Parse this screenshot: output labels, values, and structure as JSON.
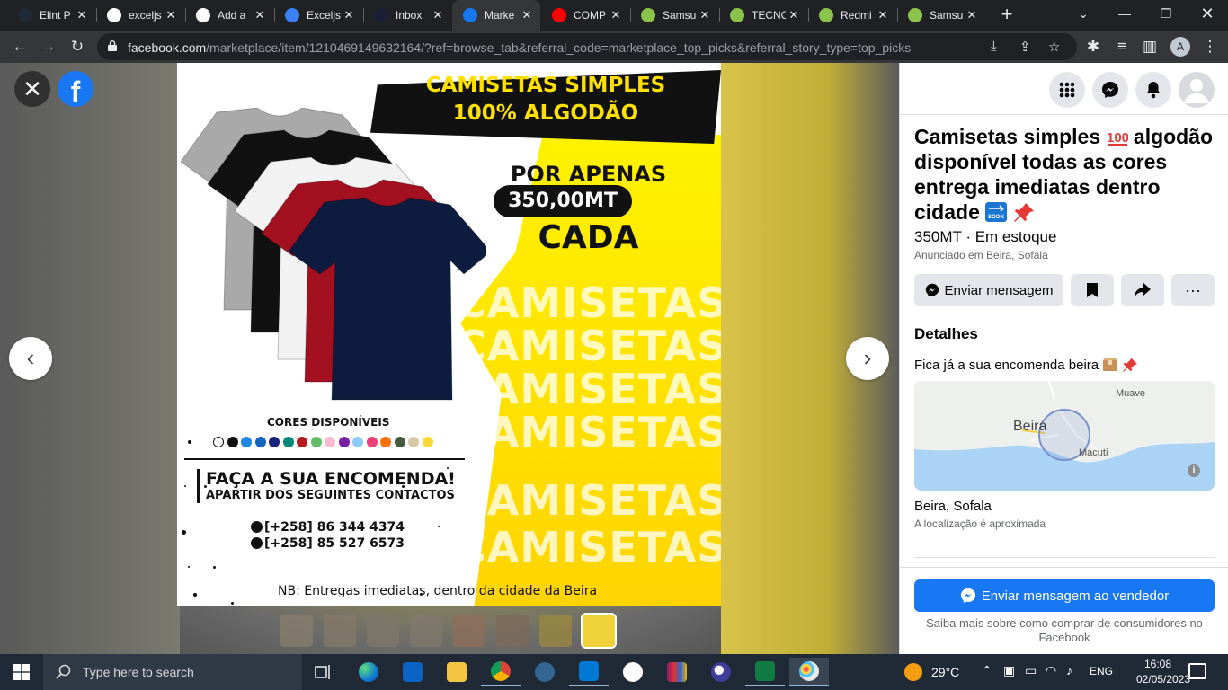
{
  "browser": {
    "tabs": [
      {
        "title": "Elint P",
        "fav_color": "#1f2a36",
        "fav_icon": "react-icon"
      },
      {
        "title": "exceljs",
        "fav_color": "#ffffff",
        "fav_icon": "github-icon"
      },
      {
        "title": "Add a",
        "fav_color": "#ffffff",
        "fav_icon": "github-icon"
      },
      {
        "title": "Exceljs",
        "fav_color": "#3b82f6",
        "fav_icon": "bolt-icon"
      },
      {
        "title": "Inbox",
        "fav_color": "#1a1f36",
        "fav_icon": "inbox-icon"
      },
      {
        "title": "Marke",
        "fav_color": "#1877f2",
        "fav_icon": "facebook-icon"
      },
      {
        "title": "COMP",
        "fav_color": "#ff0000",
        "fav_icon": "youtube-icon"
      },
      {
        "title": "Samsu",
        "fav_color": "#8bc34a",
        "fav_icon": "shop-icon"
      },
      {
        "title": "TECNO",
        "fav_color": "#8bc34a",
        "fav_icon": "shop-icon"
      },
      {
        "title": "Redmi",
        "fav_color": "#8bc34a",
        "fav_icon": "shop-icon"
      },
      {
        "title": "Samsu",
        "fav_color": "#8bc34a",
        "fav_icon": "shop-icon"
      }
    ],
    "active_tab": 5,
    "url_host": "facebook.com",
    "url_path": "/marketplace/item/1210469149632164/?ref=browse_tab&referral_code=marketplace_top_picks&referral_story_type=top_picks",
    "profile_initial": "A"
  },
  "viewer": {
    "close_symbol": "✕",
    "fb_letter": "f",
    "prev_symbol": "‹",
    "next_symbol": "›",
    "image": {
      "headline_1": "CAMISETAS SIMPLES",
      "headline_2": "100% ALGODÃO",
      "por_apenas": "POR APENAS",
      "price": "350,00MT",
      "cada": "CADA",
      "watermark": "CAMISETAS",
      "cores_label": "CORES DISPONÍVEIS",
      "swatch_colors": [
        "#ffffff",
        "#111111",
        "#1e88e5",
        "#1565c0",
        "#1a237e",
        "#00897b",
        "#b71c1c",
        "#66bb6a",
        "#f8bbd0",
        "#7b1fa2",
        "#90caf9",
        "#ec407a",
        "#ff6f00",
        "#455a3a",
        "#d7c9a8",
        "#fdd835"
      ],
      "faca_1": "FAÇA A SUA ENCOMENDA!",
      "faca_2": "APARTIR DOS SEGUINTES CONTACTOS",
      "phone_1": "[+258] 86 344 4374",
      "phone_2": "[+258] 85 527 6573",
      "nb": "NB: Entregas imediatas, dentro da cidade da Beira",
      "shirt_colors": [
        "#a9a9a9",
        "#111111",
        "#f2f2f2",
        "#a3101f",
        "#0d1b3e"
      ]
    },
    "thumb_count": 8
  },
  "listing": {
    "title": "Camisetas simples 💯 algodão disponível todas as cores entrega imediatas dentro cidade 🔜📌",
    "title_text": "Camisetas simples",
    "title_rest": "algodão disponível todas as cores entrega imediatas dentro cidade",
    "price_status": "350MT · Em estoque",
    "listed_in": "Anunciado em Beira, Sofala",
    "send_message": "Enviar mensagem",
    "details_heading": "Detalhes",
    "description": "Fica já a sua encomenda beira📦📌",
    "description_text": "Fica já a sua encomenda beira",
    "map": {
      "city": "Beira",
      "label_2": "Muave",
      "label_3": "Macuti",
      "info": "i"
    },
    "location": "Beira, Sofala",
    "location_note": "A localização é aproximada",
    "send_seller": "Enviar mensagem ao vendedor",
    "learn_more": "Saiba mais sobre como comprar de consumidores no Facebook"
  },
  "taskbar": {
    "search_placeholder": "Type here to search",
    "weather": "29°C",
    "lang": "ENG",
    "time": "16:08",
    "date": "02/05/2023"
  },
  "colors": {
    "facebook_blue": "#1877f2",
    "chrome_dark": "#202124",
    "chrome_toolbar": "#35363a",
    "taskbar": "#1f2a36"
  }
}
